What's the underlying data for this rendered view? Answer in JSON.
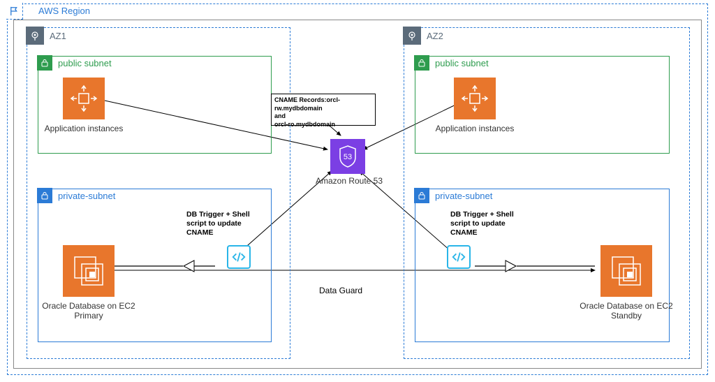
{
  "region": {
    "label": "AWS Region"
  },
  "az1": {
    "label": "AZ1",
    "public": {
      "label": "public subnet",
      "app_label": "Application instances"
    },
    "private": {
      "label": "private-subnet",
      "trigger_text": "DB Trigger + Shell script to update CNAME",
      "db_label": "Oracle Database on EC2 Primary"
    }
  },
  "az2": {
    "label": "AZ2",
    "public": {
      "label": "public subnet",
      "app_label": "Application instances"
    },
    "private": {
      "label": "private-subnet",
      "trigger_text": "DB Trigger + Shell script to update CNAME",
      "db_label": "Oracle Database on EC2 Standby"
    }
  },
  "route53": {
    "label": "Amazon Route 53"
  },
  "cname": {
    "line1": "CNAME Records:orcl-rw.mydbdomain",
    "line2": "and",
    "line3": "orcl-ro.mydbdomain"
  },
  "data_guard": "Data Guard"
}
